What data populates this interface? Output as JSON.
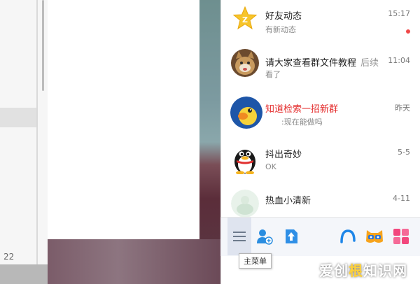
{
  "left_window": {
    "row_number": "22"
  },
  "conversations": [
    {
      "name": "好友动态",
      "preview": "有新动态",
      "time": "15:17",
      "unread": true,
      "name_color": "normal",
      "avatar": "star-icon"
    },
    {
      "name": "请大家查看群文件教程",
      "name_suffix": "后续",
      "preview": "看了",
      "time": "11:04",
      "unread": false,
      "name_color": "normal",
      "avatar": "cat-photo"
    },
    {
      "name": "知道检索一招新群",
      "preview": ":现在能做吗",
      "time": "昨天",
      "unread": false,
      "name_color": "red",
      "avatar": "duck-icon"
    },
    {
      "name": "抖出奇妙",
      "preview": "OK",
      "time": "5-5",
      "unread": false,
      "name_color": "normal",
      "avatar": "penguin-icon"
    },
    {
      "name": "热血小清新",
      "preview": "",
      "time": "4-11",
      "unread": false,
      "name_color": "normal",
      "avatar": "group-icon"
    }
  ],
  "toolbar": {
    "main_menu_tooltip": "主菜单",
    "buttons": [
      "menu-icon",
      "add-friend-icon",
      "file-transfer-icon",
      "qq-browser-icon",
      "game-icon",
      "app-grid-icon"
    ]
  },
  "colors": {
    "accent_red": "#e42d2d",
    "unread_dot": "#f04848"
  },
  "watermark": {
    "text_a": "爱创",
    "text_b": "根",
    "text_c": "知识网"
  }
}
